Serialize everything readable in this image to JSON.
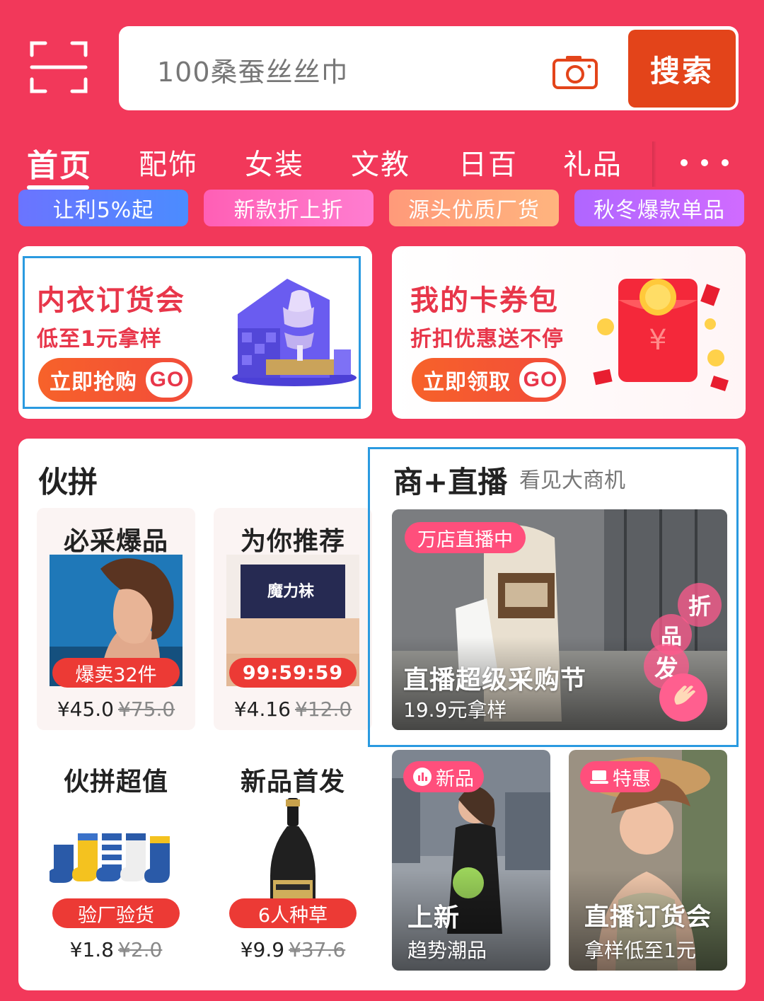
{
  "search": {
    "placeholder": "100桑蚕丝丝巾",
    "button_label": "搜索"
  },
  "tabs": [
    {
      "label": "首页",
      "active": true
    },
    {
      "label": "配饰"
    },
    {
      "label": "女装"
    },
    {
      "label": "文教"
    },
    {
      "label": "日百"
    },
    {
      "label": "礼品"
    }
  ],
  "promos": [
    {
      "label": "让利5%起"
    },
    {
      "label": "新款折上折"
    },
    {
      "label": "源头优质厂货"
    },
    {
      "label": "秋冬爆款单品"
    }
  ],
  "banners": [
    {
      "title": "内衣订货会",
      "subtitle": "低至1元拿样",
      "button": "立即抢购",
      "go": "GO"
    },
    {
      "title": "我的卡券包",
      "subtitle": "折扣优惠送不停",
      "button": "立即领取",
      "go": "GO"
    }
  ],
  "group_buy": {
    "title": "伙拼",
    "tiles": [
      {
        "title": "必采爆品",
        "badge": "爆卖32件",
        "price": "¥45.0",
        "old_price": "¥75.0"
      },
      {
        "title": "为你推荐",
        "badge": "99:59:59",
        "product_text": "魔力袜",
        "price": "¥4.16",
        "old_price": "¥12.0"
      },
      {
        "title": "伙拼超值",
        "badge": "验厂验货",
        "price": "¥1.8",
        "old_price": "¥2.0"
      },
      {
        "title": "新品首发",
        "badge": "6人种草",
        "price": "¥9.9",
        "old_price": "¥37.6"
      }
    ]
  },
  "live": {
    "title": "商+直播",
    "subtitle": "看见大商机",
    "main": {
      "tag": "万店直播中",
      "title": "直播超级采购节",
      "sub": "19.9元拿样",
      "bubbles": [
        "折",
        "品",
        "发"
      ]
    },
    "cards": [
      {
        "tag": "新品",
        "title": "上新",
        "sub": "趋势潮品"
      },
      {
        "tag": "特惠",
        "title": "直播订货会",
        "sub": "拿样低至1元"
      }
    ]
  }
}
